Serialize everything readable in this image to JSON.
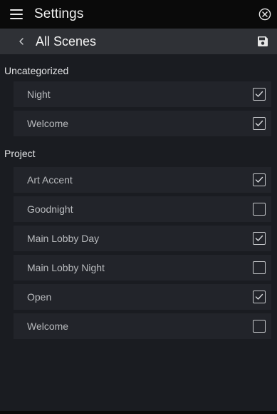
{
  "header": {
    "title": "Settings",
    "menu_icon": "hamburger-menu-icon",
    "close_icon": "close-circle-icon"
  },
  "subheader": {
    "title": "All Scenes",
    "back_icon": "chevron-left-icon",
    "save_icon": "floppy-disk-icon"
  },
  "groups": [
    {
      "label": "Uncategorized",
      "items": [
        {
          "label": "Night",
          "checked": true
        },
        {
          "label": "Welcome",
          "checked": true
        }
      ]
    },
    {
      "label": "Project",
      "items": [
        {
          "label": "Art Accent",
          "checked": true
        },
        {
          "label": "Goodnight",
          "checked": false
        },
        {
          "label": "Main Lobby Day",
          "checked": true
        },
        {
          "label": "Main Lobby Night",
          "checked": false
        },
        {
          "label": "Open",
          "checked": true
        },
        {
          "label": "Welcome",
          "checked": false
        }
      ]
    }
  ],
  "colors": {
    "topbar_bg": "#0a0a0a",
    "subheader_bg": "#2f3136",
    "content_bg": "#1a1c21",
    "row_bg": "#22242a",
    "text_primary": "#e9eaec",
    "text_secondary": "#b9bbbe"
  }
}
